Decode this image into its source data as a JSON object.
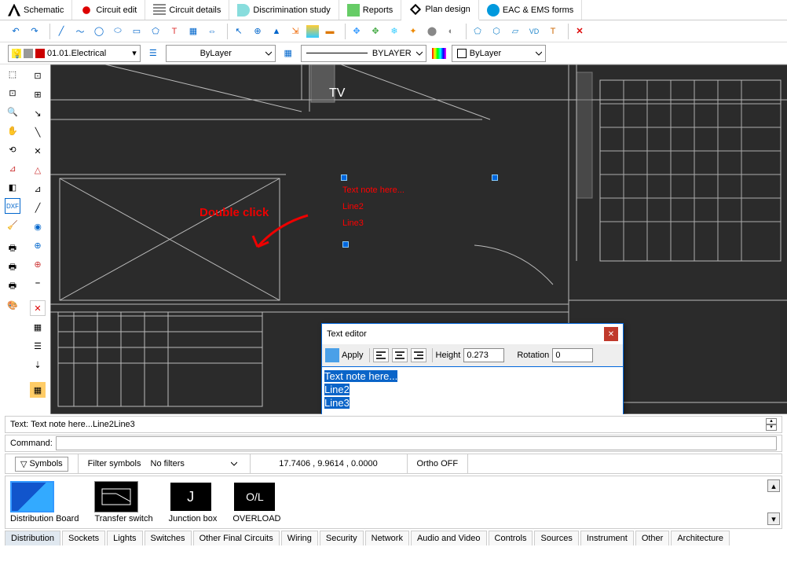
{
  "tabs": {
    "schematic": "Schematic",
    "circuit_edit": "Circuit edit",
    "circuit_details": "Circuit details",
    "discrimination": "Discrimination study",
    "reports": "Reports",
    "plan_design": "Plan design",
    "eac": "EAC & EMS forms"
  },
  "layer": {
    "current": "01.01.Electrical",
    "linetype": "ByLayer",
    "lineweight": "BYLAYER",
    "color": "ByLayer"
  },
  "canvas": {
    "tv_label": "TV",
    "note_l1": "Text note here...",
    "note_l2": "Line2",
    "note_l3": "Line3",
    "annotation": "Double click"
  },
  "dialog": {
    "title": "Text editor",
    "apply": "Apply",
    "height_label": "Height",
    "height_value": "0.273",
    "rotation_label": "Rotation",
    "rotation_value": "0",
    "body_l1": "Text note here...",
    "body_l2": "Line2",
    "body_l3": "Line3"
  },
  "cmd": {
    "text_echo": "Text: Text note here...Line2Line3",
    "command_label": "Command:"
  },
  "status": {
    "symbols_btn": "Symbols",
    "filter_label": "Filter symbols",
    "filter_value": "No filters",
    "coords": "17.7406 , 9.9614 , 0.0000",
    "ortho": "Ortho OFF"
  },
  "symbols": {
    "dist_board": "Distribution Board",
    "transfer_switch": "Transfer switch",
    "junction_box": "Junction box",
    "jb_glyph": "J",
    "overload": "OVERLOAD",
    "ol_glyph": "O/L"
  },
  "bottom_tabs": [
    "Distribution",
    "Sockets",
    "Lights",
    "Switches",
    "Other Final Circuits",
    "Wiring",
    "Security",
    "Network",
    "Audio and Video",
    "Controls",
    "Sources",
    "Instrument",
    "Other",
    "Architecture"
  ]
}
